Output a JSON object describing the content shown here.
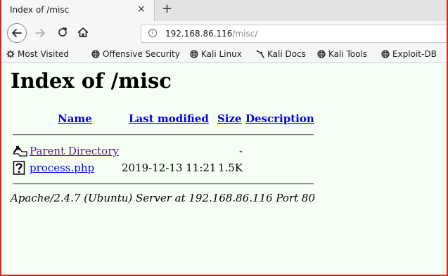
{
  "tab": {
    "title": "Index of /misc",
    "close_glyph": "×",
    "new_tab_glyph": "+"
  },
  "nav": {
    "url_host": "192.168.86.116",
    "url_path": "/misc/",
    "info_glyph": "i"
  },
  "bookmarks": [
    {
      "label": "Most Visited",
      "icon": "gear-icon"
    },
    {
      "label": "Offensive Security",
      "icon": "globe-icon"
    },
    {
      "label": "Kali Linux",
      "icon": "globe-icon"
    },
    {
      "label": "Kali Docs",
      "icon": "kali-dragon-icon"
    },
    {
      "label": "Kali Tools",
      "icon": "globe-icon"
    },
    {
      "label": "Exploit-DB",
      "icon": "globe-icon"
    }
  ],
  "page": {
    "title": "Index of /misc",
    "columns": {
      "name": "Name",
      "modified": "Last modified",
      "size": "Size",
      "description": "Description"
    },
    "rows": [
      {
        "name": "Parent Directory",
        "modified": "",
        "size": "-",
        "description": "",
        "icon": "back-folder-icon"
      },
      {
        "name": "process.php",
        "modified": "2019-12-13 11:21",
        "size": "1.5K",
        "description": "",
        "icon": "unknown-file-icon"
      }
    ],
    "address": "Apache/2.4.7 (Ubuntu) Server at 192.168.86.116 Port 80"
  }
}
